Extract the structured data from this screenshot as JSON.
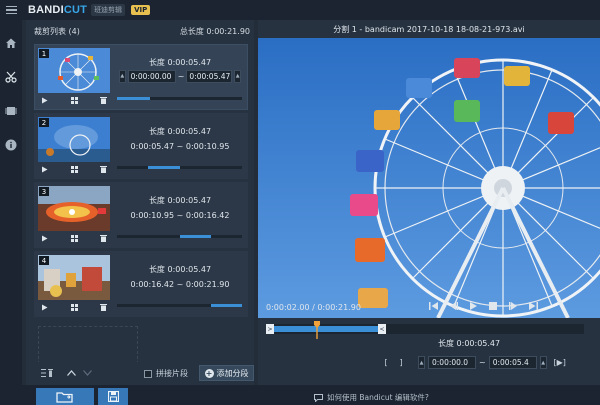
{
  "app": {
    "brand_main": "BANDI",
    "brand_accent": "CUT",
    "brand_sub": "班迪剪辑",
    "vip": "VIP"
  },
  "list": {
    "header_title": "裁剪列表 (4)",
    "total_length": "总长度 0:00:21.90",
    "clips": [
      {
        "num": "1",
        "length": "长度 0:00:05.47",
        "start": "0:00:00.00",
        "end": "0:00:05.47",
        "progress_from": 0.0,
        "progress_to": 0.26
      },
      {
        "num": "2",
        "length": "长度 0:00:05.47",
        "range": "0:00:05.47 ~ 0:00:10.95",
        "progress_from": 0.25,
        "progress_to": 0.5
      },
      {
        "num": "3",
        "length": "长度 0:00:05.47",
        "range": "0:00:10.95 ~ 0:00:16.42",
        "progress_from": 0.5,
        "progress_to": 0.75
      },
      {
        "num": "4",
        "length": "长度 0:00:05.47",
        "range": "0:00:16.42 ~ 0:00:21.90",
        "progress_from": 0.75,
        "progress_to": 1.0
      }
    ],
    "merge_label": "拼接片段",
    "add_segment_label": "添加分段"
  },
  "preview": {
    "title": "分割 1 - bandicam 2017-10-18 18-08-21-973.avi",
    "time_display": "0:00:02.00 / 0:00:21.90",
    "length": "长度 0:00:05.47",
    "start": "0:00:00.0",
    "end": "0:00:05.4",
    "bracket_start": "[",
    "bracket_end": "]",
    "play_end": "[▶]"
  },
  "footer": {
    "help_text": "如何使用 Bandicut 编辑软件?"
  },
  "colors": {
    "accent": "#3b8fd6",
    "brand_accent": "#38a6e8",
    "vip": "#e8c050"
  }
}
